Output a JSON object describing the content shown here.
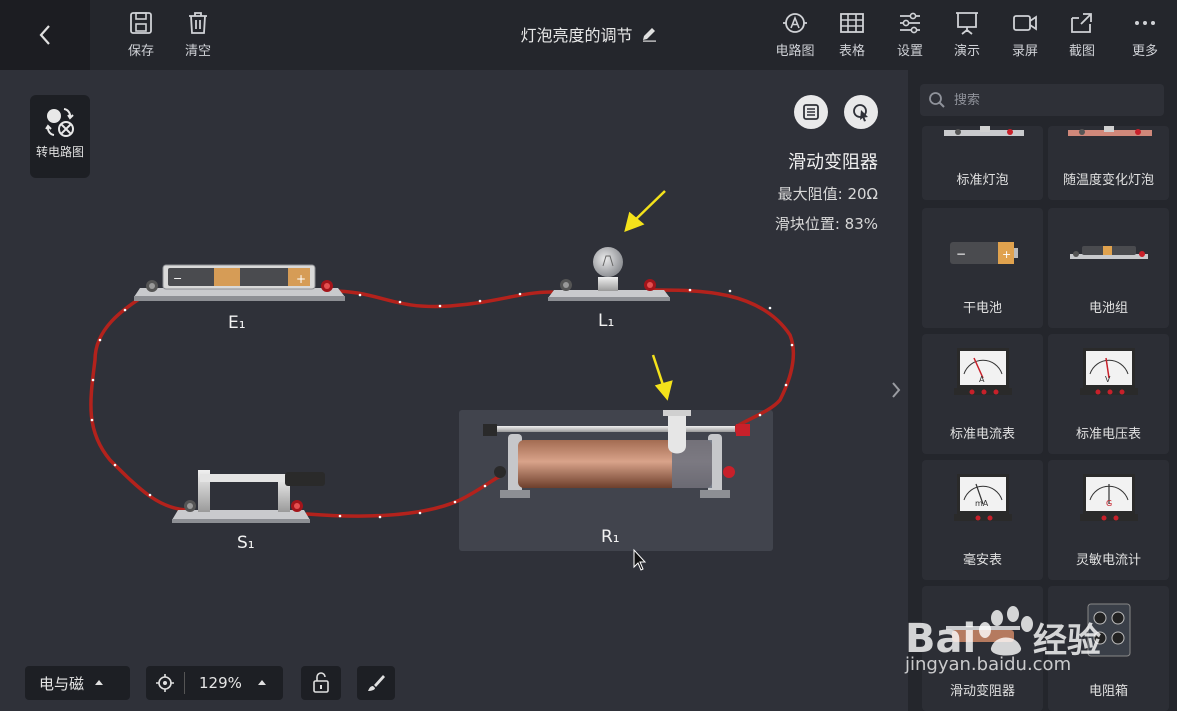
{
  "toolbar": {
    "save_label": "保存",
    "clear_label": "清空",
    "title": "灯泡亮度的调节",
    "right_tools": [
      {
        "label": "电路图",
        "icon": "ammeter-icon"
      },
      {
        "label": "表格",
        "icon": "table-icon"
      },
      {
        "label": "设置",
        "icon": "sliders-icon"
      },
      {
        "label": "演示",
        "icon": "presentation-icon"
      },
      {
        "label": "录屏",
        "icon": "video-icon"
      },
      {
        "label": "截图",
        "icon": "screenshot-icon"
      },
      {
        "label": "更多",
        "icon": "more-icon"
      }
    ]
  },
  "canvas": {
    "switch_diagram_label": "转电路图",
    "selected": {
      "name": "滑动变阻器",
      "max_resistance": "最大阻值: 20Ω",
      "slider_position": "滑块位置: 83%"
    },
    "labels": {
      "battery": "E₁",
      "bulb": "L₁",
      "switch": "S₁",
      "rheostat": "R₁"
    },
    "bottom": {
      "category": "电与磁",
      "zoom": "129%"
    }
  },
  "sidebar": {
    "search_placeholder": "搜索",
    "components": [
      "标准灯泡",
      "随温度变化灯泡",
      "干电池",
      "电池组",
      "标准电流表",
      "标准电压表",
      "毫安表",
      "灵敏电流计",
      "滑动变阻器",
      "电阻箱"
    ]
  },
  "watermark": {
    "text": "jingyan.baidu.com"
  },
  "colors": {
    "wire": "#b3221c",
    "accent_arrow": "#f4e21b",
    "topbar": "#24262c",
    "canvas": "#2f3139"
  }
}
